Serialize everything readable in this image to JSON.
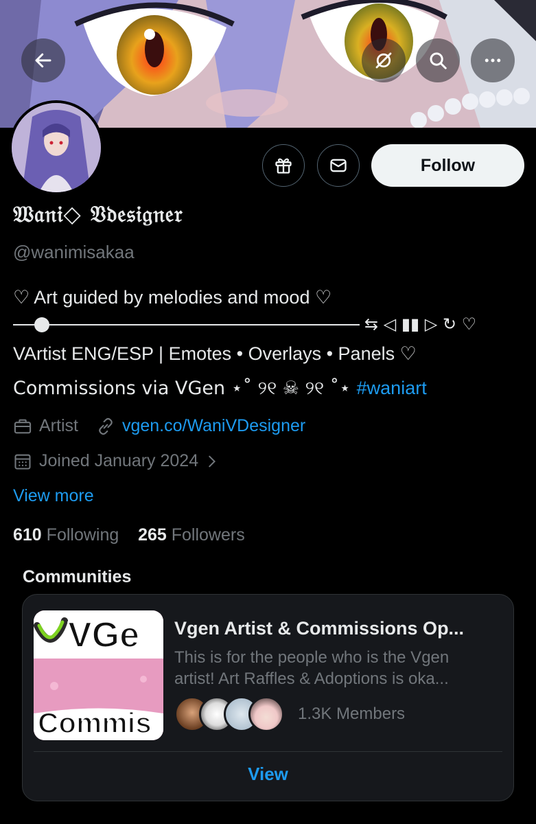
{
  "header": {
    "back_icon": "arrow-left-icon",
    "actions": [
      "repost-off-icon",
      "search-icon",
      "more-icon"
    ]
  },
  "profile": {
    "display_name": "𝔚𝔞𝔫𝔦◇ 𝔙𝔡𝔢𝔰𝔦𝔤𝔫𝔢𝔯",
    "handle": "@wanimisakaa",
    "follow_label": "Follow",
    "bio": {
      "line1": "♡ Art guided by melodies and mood ♡",
      "player_controls": "⇆ ◁ ▮▮ ▷ ↻ ♡",
      "line2": "VArtist ENG/ESP | Emotes • Overlays • Panels ♡",
      "line3_text": "Commissions via VGen ⋆˚ ୨୧ ☠ ୨୧ ˚⋆ ",
      "line3_hashtag": "#waniart"
    },
    "category": "Artist",
    "website": "vgen.co/WaniVDesigner",
    "joined": "Joined January 2024",
    "view_more": "View more",
    "following_count": "610",
    "following_label": "Following",
    "followers_count": "265",
    "followers_label": "Followers"
  },
  "communities": {
    "title": "Communities",
    "card": {
      "thumb_text_top": "VGe",
      "thumb_text_bottom": "Commis",
      "name": "Vgen Artist & Commissions Op...",
      "description_line1": "This is for the people who is the Vgen",
      "description_line2": "artist! Art Raffles & Adoptions is oka...",
      "members": "1.3K Members",
      "view_label": "View"
    }
  },
  "colors": {
    "background": "#000000",
    "text": "#e7e9ea",
    "muted": "#71767b",
    "accent": "#1d9bf0",
    "card": "#16181c",
    "border": "#2f3336"
  }
}
